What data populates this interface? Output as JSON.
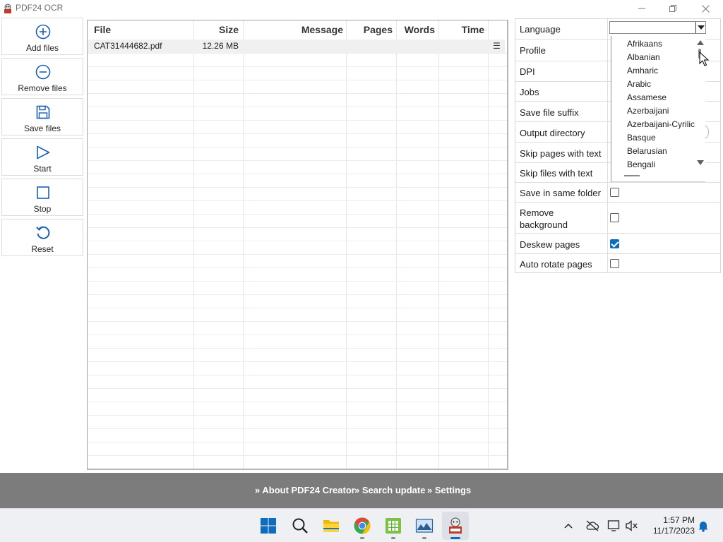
{
  "window": {
    "title": "PDF24 OCR"
  },
  "toolbar": {
    "buttons": [
      {
        "label": "Add files",
        "icon": "plus-circle-icon"
      },
      {
        "label": "Remove files",
        "icon": "minus-circle-icon"
      },
      {
        "label": "Save files",
        "icon": "save-icon"
      },
      {
        "label": "Start",
        "icon": "play-icon"
      },
      {
        "label": "Stop",
        "icon": "stop-icon"
      },
      {
        "label": "Reset",
        "icon": "reset-icon"
      }
    ]
  },
  "file_table": {
    "columns": [
      "File",
      "Size",
      "Message",
      "Pages",
      "Words",
      "Time"
    ],
    "rows": [
      {
        "file": "CAT31444682.pdf",
        "size": "12.26 MB",
        "message": "",
        "pages": "",
        "words": "",
        "time": "",
        "menu": "☰"
      }
    ]
  },
  "settings": {
    "labels": {
      "language": "Language",
      "profile": "Profile",
      "dpi": "DPI",
      "jobs": "Jobs",
      "save_file_suffix": "Save file suffix",
      "output_directory": "Output directory",
      "skip_pages_with_text": "Skip pages with text",
      "skip_files_with_text": "Skip files with text",
      "save_in_same_folder": "Save in same folder",
      "remove_background_1": "Remove",
      "remove_background_2": "background",
      "deskew_pages": "Deskew pages",
      "auto_rotate_pages": "Auto rotate pages"
    },
    "checkboxes": {
      "save_in_same_folder": false,
      "remove_background": false,
      "deskew_pages": true,
      "auto_rotate_pages": false
    },
    "language_value": "",
    "language_options": [
      "Afrikaans",
      "Albanian",
      "Amharic",
      "Arabic",
      "Assamese",
      "Azerbaijani",
      "Azerbaijani-Cyrilic",
      "Basque",
      "Belarusian",
      "Bengali"
    ]
  },
  "link_bar": {
    "links": [
      "» About PDF24 Creator",
      "» Search update",
      "» Settings"
    ]
  },
  "taskbar": {
    "apps": [
      "start-icon",
      "search-icon",
      "file-explorer-icon",
      "chrome-icon",
      "spreadsheet-app-icon",
      "image-viewer-icon",
      "pdf24-icon"
    ],
    "time": "1:57 PM",
    "date": "11/17/2023"
  },
  "colors": {
    "accent": "#0f6cbd",
    "link_bar_bg": "#7c7c7c",
    "icon_blue": "#1a5fb4"
  }
}
